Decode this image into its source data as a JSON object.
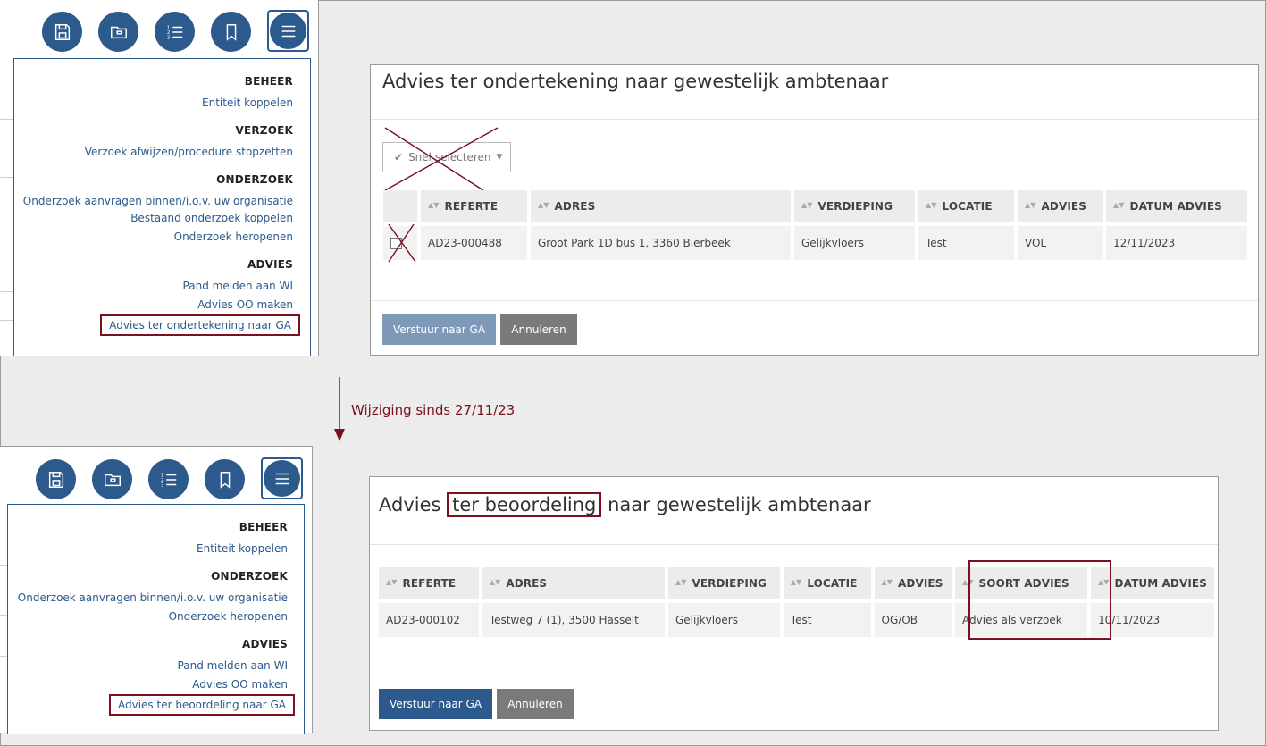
{
  "top": {
    "menu": {
      "sections": [
        {
          "title": "BEHEER",
          "links": [
            "Entiteit koppelen"
          ]
        },
        {
          "title": "VERZOEK",
          "links": [
            "Verzoek afwijzen/procedure stopzetten"
          ]
        },
        {
          "title": "ONDERZOEK",
          "links": [
            "Onderzoek aanvragen binnen/i.o.v. uw organisatie",
            "Bestaand onderzoek koppelen",
            "Onderzoek heropenen"
          ]
        },
        {
          "title": "ADVIES",
          "links": [
            "Pand melden aan WI",
            "Advies OO maken",
            "Advies ter ondertekening naar GA"
          ]
        }
      ]
    },
    "dialog": {
      "title": "Advies ter ondertekening naar gewestelijk ambtenaar",
      "quick_select": "Snel selecteren",
      "columns": [
        "REFERTE",
        "ADRES",
        "VERDIEPING",
        "LOCATIE",
        "ADVIES",
        "DATUM ADVIES"
      ],
      "rows": [
        [
          "AD23-000488",
          "Groot Park 1D bus 1, 3360 Bierbeek",
          "Gelijkvloers",
          "Test",
          "VOL",
          "12/11/2023"
        ]
      ],
      "send_label": "Verstuur naar GA",
      "cancel_label": "Annuleren"
    }
  },
  "annotation": {
    "label": "Wijziging sinds 27/11/23"
  },
  "bottom": {
    "menu": {
      "sections": [
        {
          "title": "BEHEER",
          "links": [
            "Entiteit koppelen"
          ]
        },
        {
          "title": "ONDERZOEK",
          "links": [
            "Onderzoek aanvragen binnen/i.o.v. uw organisatie",
            "Onderzoek heropenen"
          ]
        },
        {
          "title": "ADVIES",
          "links": [
            "Pand melden aan WI",
            "Advies OO maken",
            "Advies ter beoordeling naar GA"
          ]
        }
      ]
    },
    "dialog": {
      "title_pre": "Advies",
      "title_hl": "ter beoordeling",
      "title_post": "naar gewestelijk ambtenaar",
      "columns": [
        "REFERTE",
        "ADRES",
        "VERDIEPING",
        "LOCATIE",
        "ADVIES",
        "SOORT ADVIES",
        "DATUM ADVIES"
      ],
      "rows": [
        [
          "AD23-000102",
          "Testweg 7 (1), 3500 Hasselt",
          "Gelijkvloers",
          "Test",
          "OG/OB",
          "Advies als verzoek",
          "10/11/2023"
        ]
      ],
      "send_label": "Verstuur naar GA",
      "cancel_label": "Annuleren"
    }
  },
  "colors": {
    "primary": "#2c5a8c",
    "highlight": "#7a1020",
    "secondary": "#7a7a7a"
  },
  "icons": [
    "save-icon",
    "folder-icon",
    "numbered-list-icon",
    "bookmark-icon",
    "menu-icon"
  ]
}
